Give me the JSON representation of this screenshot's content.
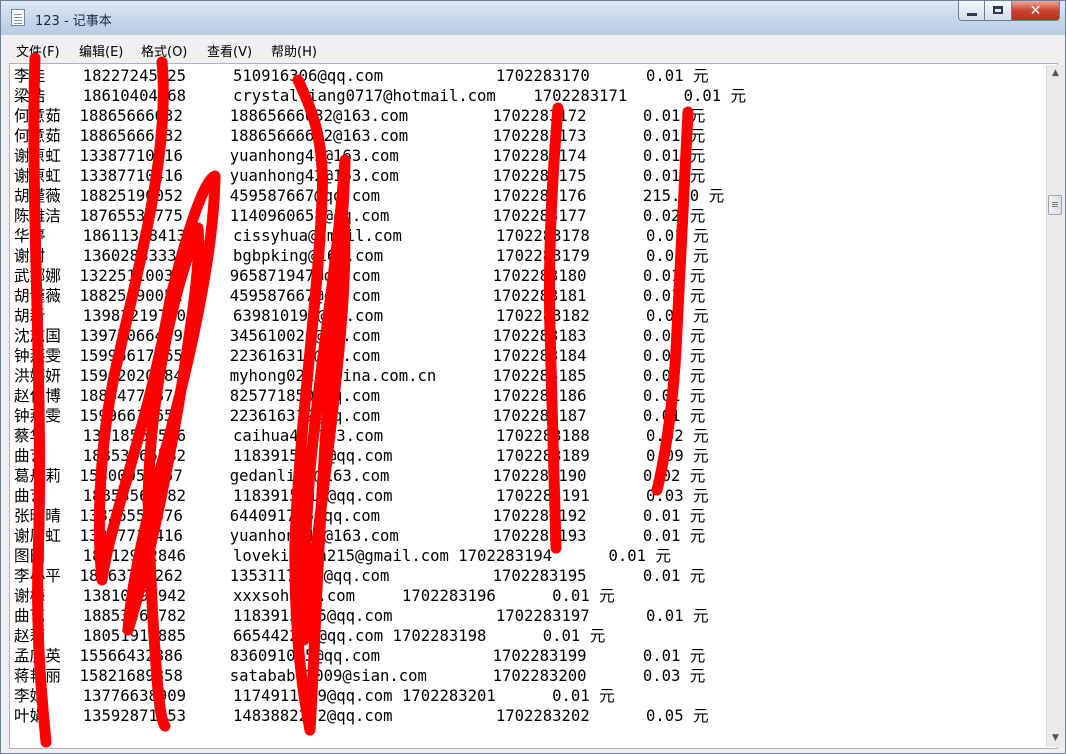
{
  "window": {
    "title": "123 - 记事本",
    "close_glyph": "✕"
  },
  "menu": [
    "文件(F)",
    "编辑(E)",
    "格式(O)",
    "查看(V)",
    "帮助(H)"
  ],
  "lines": [
    "李佳    18227245025     510916306@qq.com            1702283170      0.01 元",
    "梁浩    18610404268     crystalliang0717@hotmail.com    1702283171      0.01 元",
    "何意茹  18865666632     18865666632@163.com         1702283172      0.01 元",
    "何意茹  18865666632     18865666632@163.com         1702283173      0.01 元",
    "谢原虹  13387710416     yuanhong42@163.com          1702283174      0.01 元",
    "谢原虹  13387710416     yuanhong42@163.com          1702283175      0.01 元",
    "胡谨薇  18825190052     459587667@qq.com            1702283176      215.00 元",
    "陈雅洁  18765538775     1140960658@qq.com           1702283177      0.02 元",
    "华婷    18611388413     cissyhua@gmail.com          1702283178      0.01 元",
    "谢尉    13602883330     bgbpking@163.com            1702283179      0.02 元",
    "武娜娜  13225110035     965871947@qq.com            1702283180      0.01 元",
    "胡谨薇  18825190052     459587667@qq.com            1702283181      0.01 元",
    "胡新    13982219710     639810190@qq.com            1702283182      0.02 元",
    "沈志国  13977066409     345610020@qq.com            1702283183      0.01 元",
    "钟燕雯  15996617765     223616312@qq.com            1702283184      0.01 元",
    "洪婷妍  15902020984     myhong0213@sina.com.cn      1702283185      0.01 元",
    "赵仁博  18834778878     825771850@qq.com            1702283186      0.01 元",
    "钟燕雯  15996617655     223616312@qq.com            1702283187      0.01 元",
    "蔡华    13818565596     caihua45@163.com            1702283188      0.02 元",
    "曲艺    18853565782     1183915715@qq.com           1702283189      0.09 元",
    "葛丹莉  15800057957     gedanli09@163.com           1702283190      0.02 元",
    "曲艺    18853565782     1183915715@qq.com           1702283191      0.03 元",
    "张晓晴  13826551376     644091765@qq.com            1702283192      0.01 元",
    "谢原虹  13387710416     yuanhong42@163.com          1702283193      0.01 元",
    "图田    18612972846     lovekitten215@gmail.com 1702283194      0.01 元",
    "李小平  18063738262     1353117575@qq.com           1702283195      0.01 元",
    "谢梅    13810599942     xxxsohusn.com     1702283196      0.01 元",
    "曲艺    18853565782     1183915715@qq.com           1702283197      0.01 元",
    "赵莉    18051917885     665442226@qq.com 1702283198      0.01 元",
    "孟庆英  15566432886     836091055@qq.com            1702283199      0.01 元",
    "蒋艳丽  15821689858     satababy2009@sian.com       1702283200      0.03 元",
    "李娟    13776638909     1174911119@qq.com 1702283201      0.01 元",
    "叶娟    13592871553     1483882202@qq.com           1702283202      0.05 元"
  ],
  "scrollbar": {
    "up_glyph": "▲",
    "down_glyph": "▼"
  },
  "scribble_color": "#ff0000"
}
